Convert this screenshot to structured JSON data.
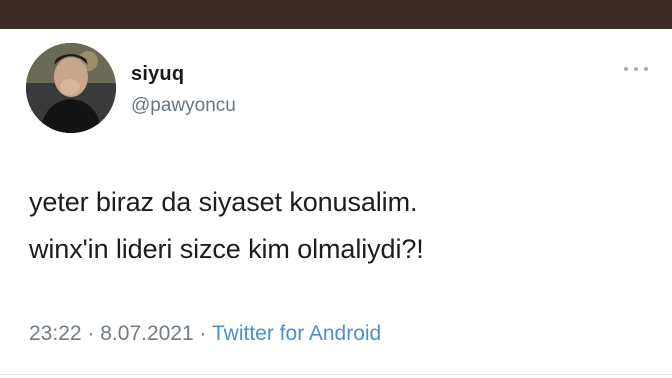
{
  "tweet": {
    "display_name": "siyuq",
    "handle": "@pawyoncu",
    "text_lines": [
      "yeter biraz da siyaset konusalim.",
      "winx'in lideri sizce kim olmaliydi?!"
    ],
    "time": "23:22",
    "separator": "·",
    "date": "8.07.2021",
    "client": "Twitter for Android"
  },
  "icons": {
    "more": "more-horizontal-icon",
    "avatar": "profile-photo"
  },
  "colors": {
    "top_bar": "#3d2b28",
    "text": "#1d1d1d",
    "secondary": "#717c86",
    "link": "#4a8fcf"
  }
}
